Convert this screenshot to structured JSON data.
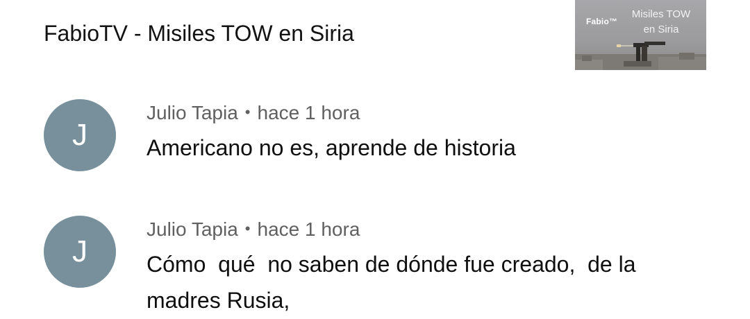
{
  "video": {
    "title": "FabioTV - Misiles TOW en Siria",
    "thumbnail": {
      "brand": "Fabio™",
      "caption_line1": "Misiles TOW",
      "caption_line2": "en Siria"
    }
  },
  "comments": [
    {
      "avatar_letter": "J",
      "author": "Julio Tapia",
      "separator": "•",
      "time": "hace 1 hora",
      "text": "Americano no es, aprende de historia"
    },
    {
      "avatar_letter": "J",
      "author": "Julio Tapia",
      "separator": "•",
      "time": "hace 1 hora",
      "text": "Cómo  qué  no saben de dónde fue creado,  de la madres Rusia,"
    }
  ],
  "colors": {
    "avatar_bg": "#78909c",
    "meta_text": "#606060",
    "primary_text": "#0f0f0f"
  }
}
